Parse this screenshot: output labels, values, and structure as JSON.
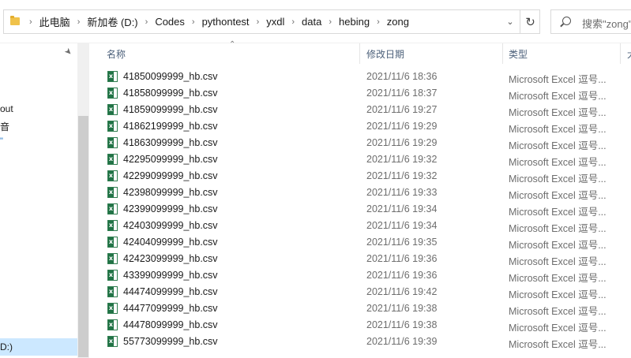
{
  "address_bar": {
    "breadcrumbs": [
      "此电脑",
      "新加卷 (D:)",
      "Codes",
      "pythontest",
      "yxdl",
      "data",
      "hebing",
      "zong"
    ]
  },
  "search": {
    "placeholder": "搜索\"zong\""
  },
  "nav": {
    "item_out": "out",
    "item_cn": "音",
    "item_blue": "\"",
    "drive": "D:)"
  },
  "columns": {
    "name": "名称",
    "date": "修改日期",
    "type": "类型",
    "size": "大"
  },
  "files": [
    {
      "name": "41850099999_hb.csv",
      "date": "2021/11/6 18:36",
      "type": "Microsoft Excel 逗号..."
    },
    {
      "name": "41858099999_hb.csv",
      "date": "2021/11/6 18:37",
      "type": "Microsoft Excel 逗号..."
    },
    {
      "name": "41859099999_hb.csv",
      "date": "2021/11/6 19:27",
      "type": "Microsoft Excel 逗号..."
    },
    {
      "name": "41862199999_hb.csv",
      "date": "2021/11/6 19:29",
      "type": "Microsoft Excel 逗号..."
    },
    {
      "name": "41863099999_hb.csv",
      "date": "2021/11/6 19:29",
      "type": "Microsoft Excel 逗号..."
    },
    {
      "name": "42295099999_hb.csv",
      "date": "2021/11/6 19:32",
      "type": "Microsoft Excel 逗号..."
    },
    {
      "name": "42299099999_hb.csv",
      "date": "2021/11/6 19:32",
      "type": "Microsoft Excel 逗号..."
    },
    {
      "name": "42398099999_hb.csv",
      "date": "2021/11/6 19:33",
      "type": "Microsoft Excel 逗号..."
    },
    {
      "name": "42399099999_hb.csv",
      "date": "2021/11/6 19:34",
      "type": "Microsoft Excel 逗号..."
    },
    {
      "name": "42403099999_hb.csv",
      "date": "2021/11/6 19:34",
      "type": "Microsoft Excel 逗号..."
    },
    {
      "name": "42404099999_hb.csv",
      "date": "2021/11/6 19:35",
      "type": "Microsoft Excel 逗号..."
    },
    {
      "name": "42423099999_hb.csv",
      "date": "2021/11/6 19:36",
      "type": "Microsoft Excel 逗号..."
    },
    {
      "name": "43399099999_hb.csv",
      "date": "2021/11/6 19:36",
      "type": "Microsoft Excel 逗号..."
    },
    {
      "name": "44474099999_hb.csv",
      "date": "2021/11/6 19:42",
      "type": "Microsoft Excel 逗号..."
    },
    {
      "name": "44477099999_hb.csv",
      "date": "2021/11/6 19:38",
      "type": "Microsoft Excel 逗号..."
    },
    {
      "name": "44478099999_hb.csv",
      "date": "2021/11/6 19:38",
      "type": "Microsoft Excel 逗号..."
    },
    {
      "name": "55773099999_hb.csv",
      "date": "2021/11/6 19:39",
      "type": "Microsoft Excel 逗号..."
    }
  ],
  "icons": {
    "folder": "folder-icon",
    "refresh": "refresh-icon",
    "search": "search-icon",
    "pin": "pin-icon",
    "file": "excel-csv-file-icon"
  },
  "colors": {
    "selection": "#cce8ff",
    "excel_green": "#217346",
    "header_text": "#4c607a"
  }
}
